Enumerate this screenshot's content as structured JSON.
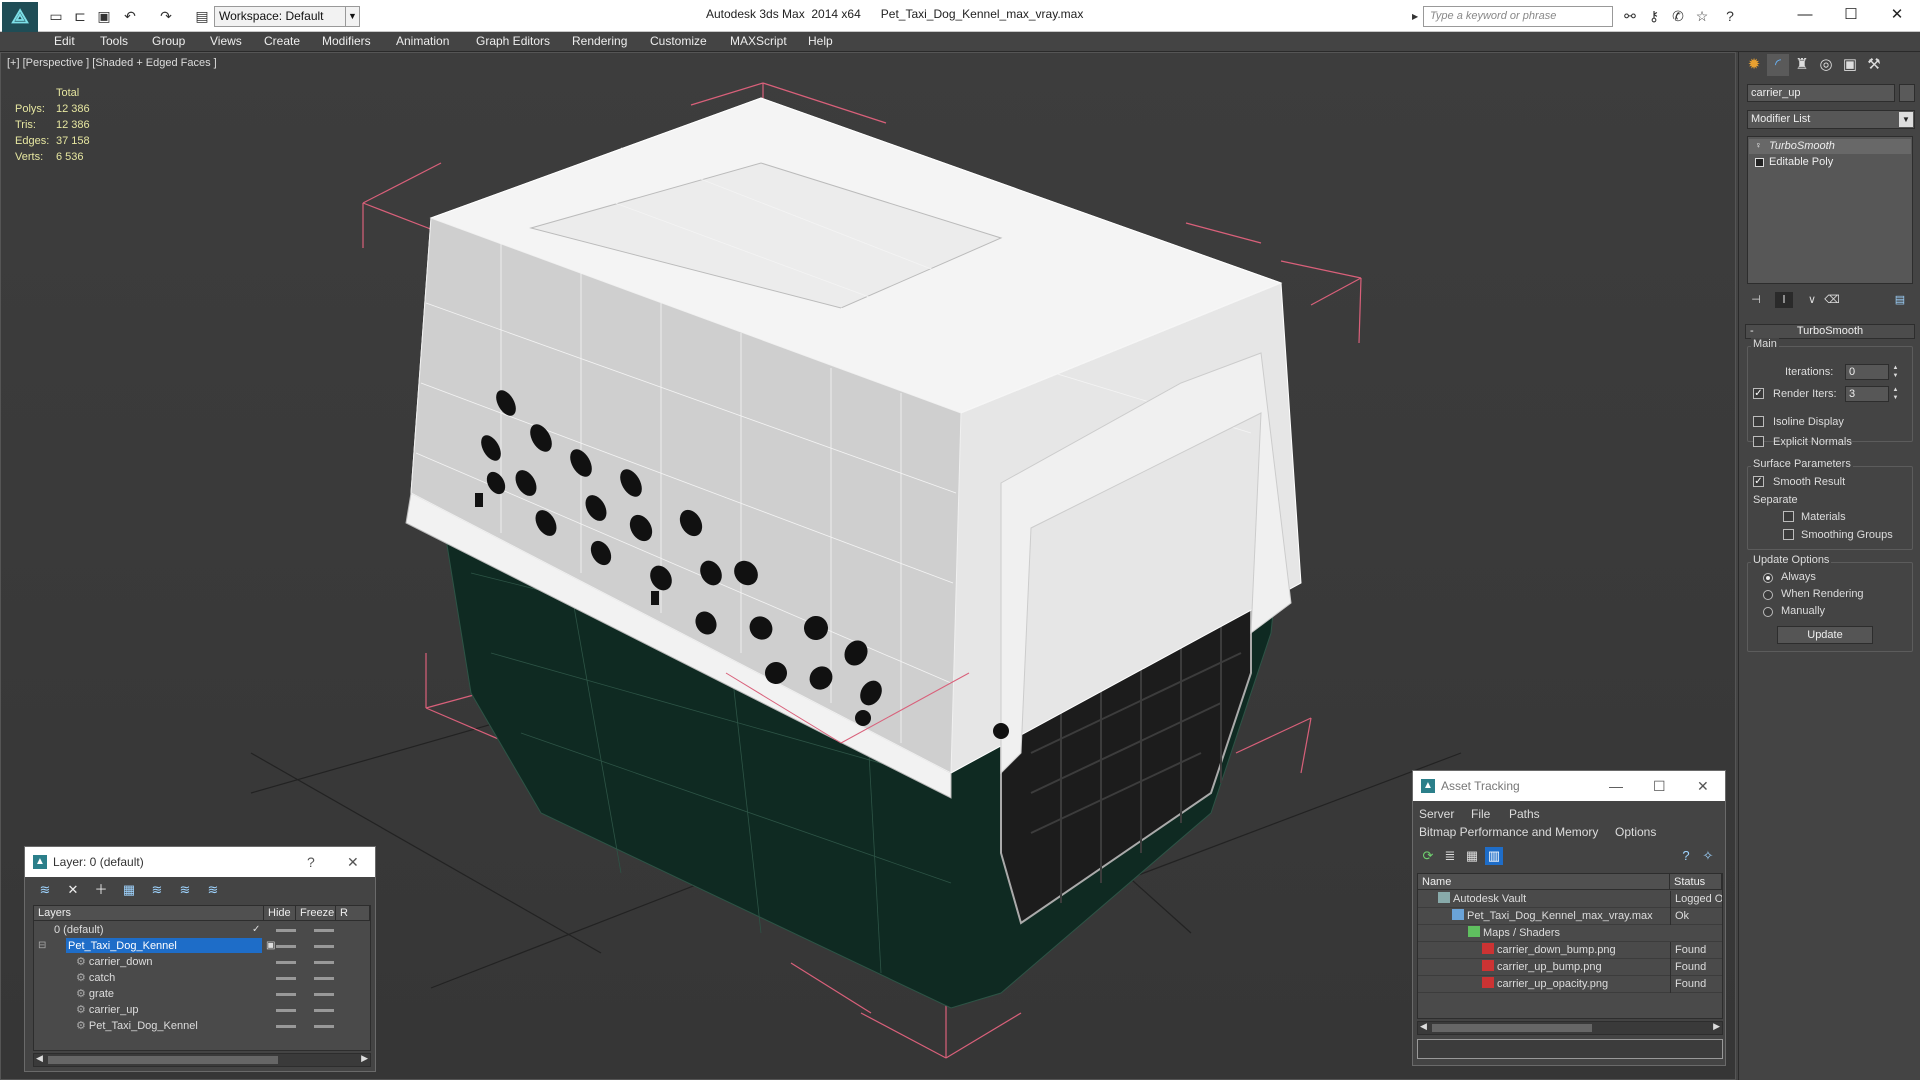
{
  "titlebar": {
    "workspace": "Workspace: Default",
    "app_title": "Autodesk 3ds Max  2014 x64",
    "file_title": "Pet_Taxi_Dog_Kennel_max_vray.max",
    "search_placeholder": "Type a keyword or phrase"
  },
  "menu": [
    "Edit",
    "Tools",
    "Group",
    "Views",
    "Create",
    "Modifiers",
    "Animation",
    "Graph Editors",
    "Rendering",
    "Customize",
    "MAXScript",
    "Help"
  ],
  "viewport": {
    "label": "[+] [Perspective ] [Shaded + Edged Faces ]",
    "stats": {
      "header": "Total",
      "rows": [
        {
          "label": "Polys:",
          "value": "12 386"
        },
        {
          "label": "Tris:",
          "value": "12 386"
        },
        {
          "label": "Edges:",
          "value": "37 158"
        },
        {
          "label": "Verts:",
          "value": "6 536"
        }
      ]
    }
  },
  "layer_dialog": {
    "title": "Layer: 0 (default)",
    "help": "?",
    "close": "✕",
    "headers": [
      "Layers",
      "Hide",
      "Freeze",
      "R"
    ],
    "rows": [
      {
        "name": "0 (default)",
        "indent": 0
      },
      {
        "name": "Pet_Taxi_Dog_Kennel",
        "indent": 0
      },
      {
        "name": "carrier_down",
        "indent": 1
      },
      {
        "name": "catch",
        "indent": 1
      },
      {
        "name": "grate",
        "indent": 1
      },
      {
        "name": "carrier_up",
        "indent": 1
      },
      {
        "name": "Pet_Taxi_Dog_Kennel",
        "indent": 1
      }
    ]
  },
  "asset_dialog": {
    "title": "Asset Tracking",
    "menu1": [
      "Server",
      "File",
      "Paths"
    ],
    "menu2": [
      "Bitmap Performance and Memory",
      "Options"
    ],
    "headers": [
      "Name",
      "Status"
    ],
    "rows": [
      {
        "name": "Autodesk Vault",
        "status": "Logged O"
      },
      {
        "name": "Pet_Taxi_Dog_Kennel_max_vray.max",
        "status": "Ok"
      },
      {
        "name": "Maps / Shaders",
        "status": ""
      },
      {
        "name": "carrier_down_bump.png",
        "status": "Found"
      },
      {
        "name": "carrier_up_bump.png",
        "status": "Found"
      },
      {
        "name": "carrier_up_opacity.png",
        "status": "Found"
      }
    ]
  },
  "command_panel": {
    "object_name": "carrier_up",
    "modifier_list": "Modifier List",
    "stack": [
      "TurboSmooth",
      "Editable Poly"
    ],
    "rollout_title": "TurboSmooth",
    "main_group": "Main",
    "iterations_label": "Iterations:",
    "iterations_value": "0",
    "render_iters_label": "Render Iters:",
    "render_iters_value": "3",
    "isoline_label": "Isoline Display",
    "explicit_normals_label": "Explicit Normals",
    "surface_group": "Surface Parameters",
    "smooth_result_label": "Smooth Result",
    "separate_label": "Separate",
    "materials_label": "Materials",
    "smoothing_groups_label": "Smoothing Groups",
    "update_group": "Update Options",
    "always_label": "Always",
    "when_rendering_label": "When Rendering",
    "manually_label": "Manually",
    "update_button": "Update"
  }
}
